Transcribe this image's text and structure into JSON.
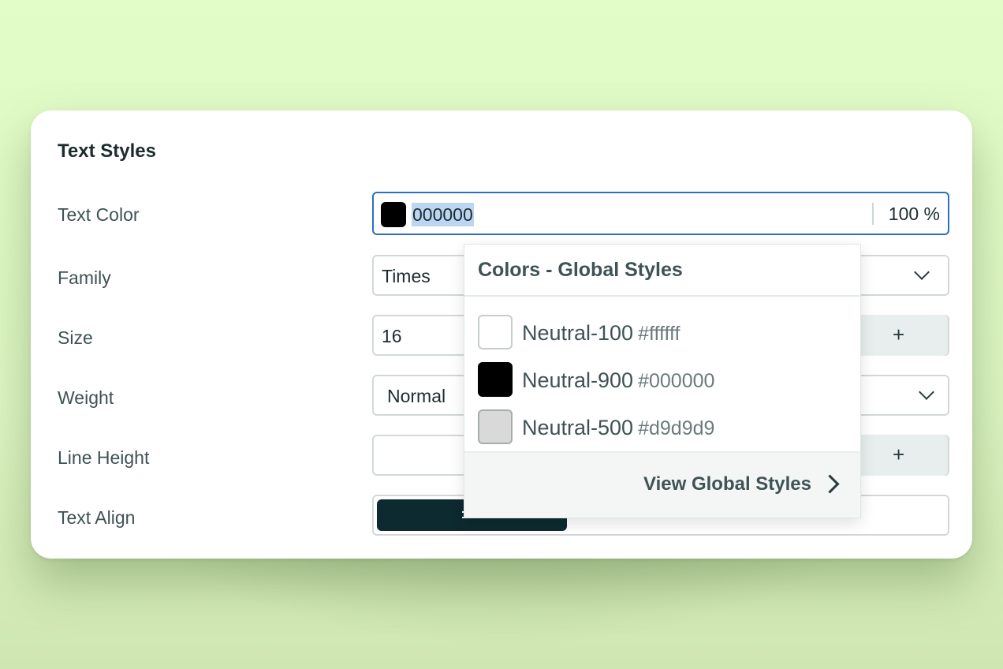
{
  "panel": {
    "title": "Text Styles",
    "rows": {
      "text_color": {
        "label": "Text Color",
        "hex": "000000",
        "opacity": "100 %",
        "swatch_color": "#000000"
      },
      "family": {
        "label": "Family",
        "value": "Times"
      },
      "size": {
        "label": "Size",
        "value": "16",
        "increment_symbol": "+"
      },
      "weight": {
        "label": "Weight",
        "value": "Normal"
      },
      "line_height": {
        "label": "Line Height",
        "value": "",
        "increment_symbol": "+"
      },
      "text_align": {
        "label": "Text Align",
        "selected": "left"
      }
    }
  },
  "color_dropdown": {
    "title": "Colors - Global Styles",
    "items": [
      {
        "name": "Neutral-100",
        "hex": "#ffffff",
        "swatch": "#ffffff"
      },
      {
        "name": "Neutral-900",
        "hex": "#000000",
        "swatch": "#000000"
      },
      {
        "name": "Neutral-500",
        "hex": "#d9d9d9",
        "swatch": "#d9d9d9"
      }
    ],
    "footer_link": "View Global Styles"
  },
  "colors": {
    "accent_border": "#2b6fc4",
    "selection_highlight": "#bcd6f2",
    "align_active_bg": "#0c2a30"
  }
}
